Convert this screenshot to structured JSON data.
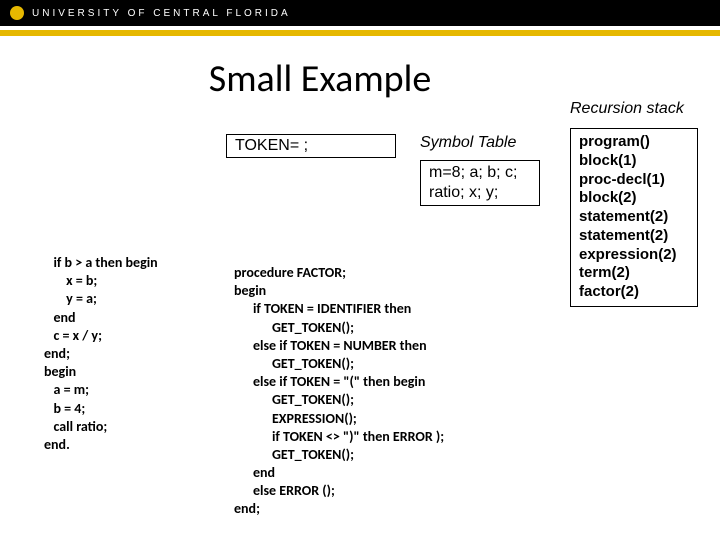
{
  "header": {
    "university": "UNIVERSITY OF CENTRAL FLORIDA"
  },
  "title": "Small Example",
  "token_box": "TOKEN= ;",
  "symbol_table_label": "Symbol Table",
  "symbol_table_content": "m=8; a; b; c;\nratio; x; y;",
  "recursion_label": "Recursion stack",
  "recursion_items": "program()\nblock(1)\nproc-decl(1)\nblock(2)\nstatement(2)\nstatement(2)\nexpression(2)\nterm(2)\nfactor(2)",
  "code_left": "   if b > a then begin\n       x = b;\n       y = a;\n   end\n   c = x / y;\nend;\nbegin\n   a = m;\n   b = 4;\n   call ratio;\nend.",
  "code_mid": "procedure FACTOR;\nbegin\n      if TOKEN = IDENTIFIER then\n            GET_TOKEN();\n      else if TOKEN = NUMBER then\n            GET_TOKEN();\n      else if TOKEN = \"(\" then begin\n            GET_TOKEN();\n            EXPRESSION();\n            if TOKEN <> \")\" then ERROR );\n            GET_TOKEN();\n      end\n      else ERROR ();\nend;"
}
